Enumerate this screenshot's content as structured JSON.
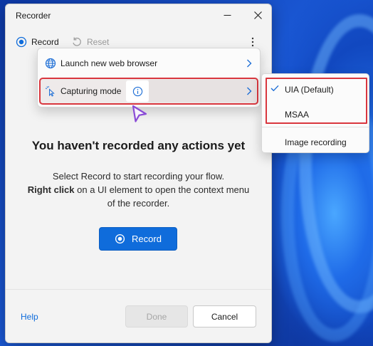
{
  "window": {
    "title": "Recorder"
  },
  "toolbar": {
    "record_label": "Record",
    "reset_label": "Reset",
    "more_icon": "more-vertical-icon"
  },
  "menu": {
    "items": [
      {
        "label": "Launch new web browser",
        "icon": "globe-icon",
        "has_submenu": true
      },
      {
        "label": "Capturing mode",
        "icon": "pointer-sparkle-icon",
        "has_submenu": true,
        "info_icon": "info-icon"
      }
    ]
  },
  "submenu": {
    "items": [
      {
        "label": "UIA (Default)",
        "checked": true
      },
      {
        "label": "MSAA",
        "checked": false
      },
      {
        "label": "Image recording",
        "checked": false
      }
    ]
  },
  "empty_state": {
    "title": "You haven't recorded any actions yet",
    "desc_line1": "Select Record to start recording your flow.",
    "desc_bold": "Right click",
    "desc_rest": " on a UI element to open the context menu of the recorder.",
    "record_button": "Record"
  },
  "footer": {
    "help_label": "Help",
    "done_label": "Done",
    "cancel_label": "Cancel"
  },
  "colors": {
    "accent": "#0f6cdb",
    "highlight_outline": "#d9363e",
    "cursor": "#8a4bd6"
  }
}
